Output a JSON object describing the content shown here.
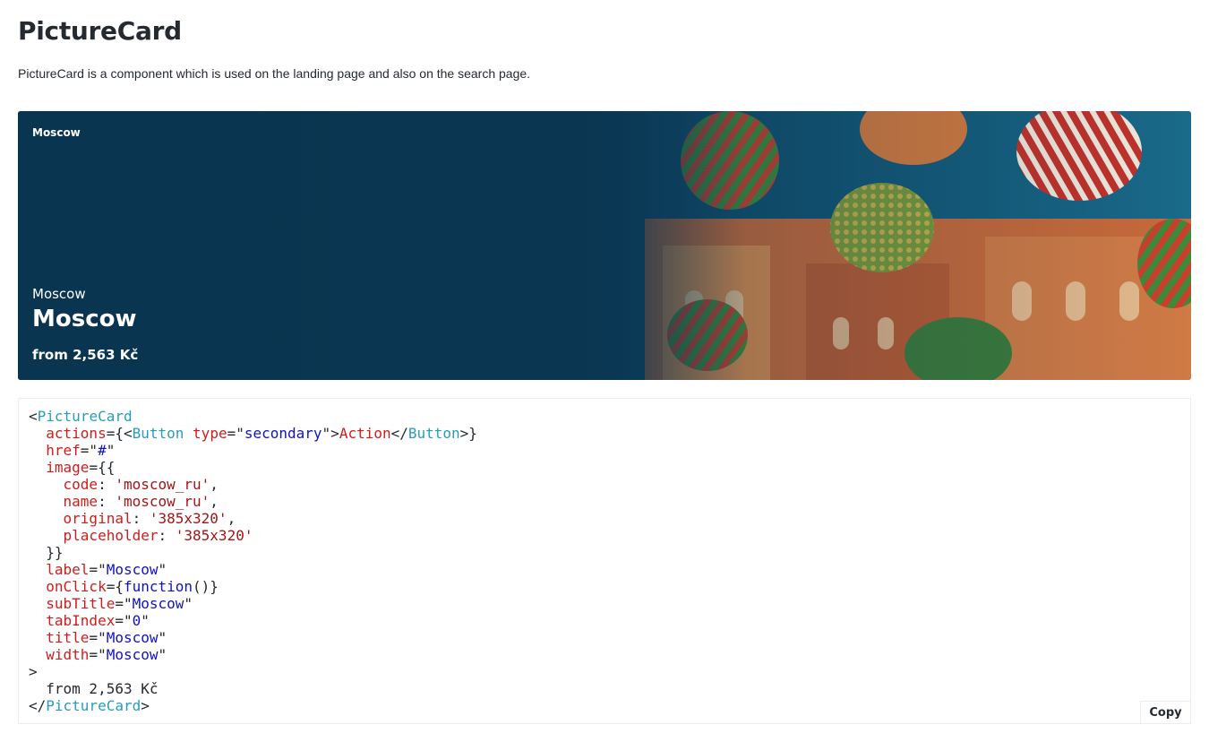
{
  "page": {
    "title": "PictureCard",
    "description": "PictureCard is a component which is used on the landing page and also on the search page."
  },
  "card": {
    "label": "Moscow",
    "subtitle": "Moscow",
    "title": "Moscow",
    "price": "from 2,563 Kč",
    "image_subject": "St. Basil's Cathedral onion domes"
  },
  "code": {
    "tag": "PictureCard",
    "button_tag": "Button",
    "button_type": "secondary",
    "button_text": "Action",
    "props": {
      "actions": "actions",
      "href": "href",
      "href_value": "#",
      "image": "image",
      "image_code_key": "code",
      "image_code": "'moscow_ru'",
      "image_name_key": "name",
      "image_name": "'moscow_ru'",
      "image_original_key": "original",
      "image_original": "'385x320'",
      "image_placeholder_key": "placeholder",
      "image_placeholder": "'385x320'",
      "label": "label",
      "label_value": "Moscow",
      "onClick": "onClick",
      "onClick_value": "function",
      "subTitle": "subTitle",
      "subTitle_value": "Moscow",
      "tabIndex": "tabIndex",
      "tabIndex_value": "0",
      "title": "title",
      "title_value": "Moscow",
      "width": "width",
      "width_value": "Moscow"
    },
    "children": "from 2,563 Kč"
  },
  "copy_button": "Copy",
  "colors": {
    "tag": "#2a9cbb",
    "attr": "#d21c1c",
    "string": "#1111c4",
    "card_bg": "#0c4363"
  }
}
